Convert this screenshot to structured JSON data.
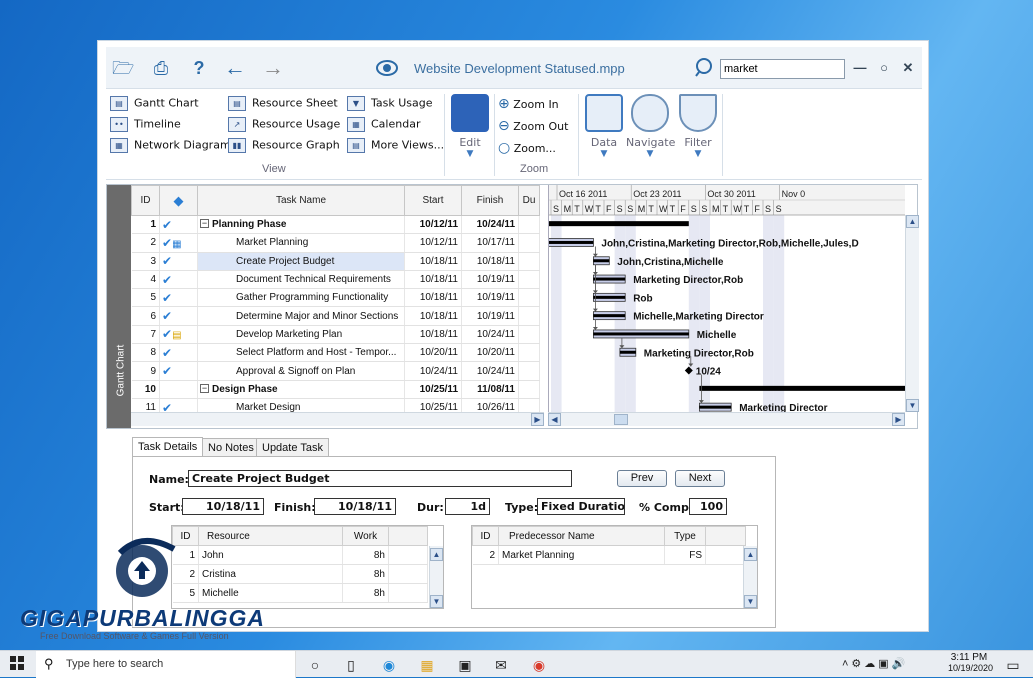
{
  "window": {
    "title": "Website Development Statused.mpp",
    "search_value": "market",
    "toolbar_icons": [
      "folder-open-icon",
      "print-icon",
      "help-icon",
      "back-arrow-icon",
      "forward-arrow-icon",
      "eye-icon"
    ]
  },
  "ribbon": {
    "view_items": [
      {
        "label": "Gantt Chart",
        "icon": "gantt-chart-icon"
      },
      {
        "label": "Timeline",
        "icon": "timeline-icon"
      },
      {
        "label": "Network Diagram",
        "icon": "network-diagram-icon"
      },
      {
        "label": "Resource Sheet",
        "icon": "resource-sheet-icon"
      },
      {
        "label": "Resource Usage",
        "icon": "resource-usage-icon"
      },
      {
        "label": "Resource Graph",
        "icon": "resource-graph-icon"
      },
      {
        "label": "Task Usage",
        "icon": "task-usage-icon"
      },
      {
        "label": "Calendar",
        "icon": "calendar-icon"
      },
      {
        "label": "More Views...",
        "icon": "more-views-icon"
      }
    ],
    "view_group_label": "View",
    "edit_label": "Edit",
    "zoom_items": [
      "Zoom In",
      "Zoom Out",
      "Zoom..."
    ],
    "zoom_group_label": "Zoom",
    "data_label": "Data",
    "navigate_label": "Navigate",
    "filter_label": "Filter"
  },
  "gantt": {
    "side_label": "Gantt Chart",
    "columns": [
      "ID",
      "",
      "Task Name",
      "Start",
      "Finish",
      "Du"
    ],
    "rows": [
      {
        "id": "1",
        "name": "Planning Phase",
        "start": "10/12/11",
        "finish": "10/24/11",
        "summary": true,
        "check": true,
        "extra": ""
      },
      {
        "id": "2",
        "name": "Market Planning",
        "start": "10/12/11",
        "finish": "10/17/11",
        "summary": false,
        "check": true,
        "extra": "table"
      },
      {
        "id": "3",
        "name": "Create Project Budget",
        "start": "10/18/11",
        "finish": "10/18/11",
        "summary": false,
        "check": true,
        "extra": "",
        "selected": true
      },
      {
        "id": "4",
        "name": "Document Technical Requirements",
        "start": "10/18/11",
        "finish": "10/19/11",
        "summary": false,
        "check": true,
        "extra": ""
      },
      {
        "id": "5",
        "name": "Gather Programming Functionality",
        "start": "10/18/11",
        "finish": "10/19/11",
        "summary": false,
        "check": true,
        "extra": ""
      },
      {
        "id": "6",
        "name": "Determine Major and Minor Sections",
        "start": "10/18/11",
        "finish": "10/19/11",
        "summary": false,
        "check": true,
        "extra": ""
      },
      {
        "id": "7",
        "name": "Develop Marketing Plan",
        "start": "10/18/11",
        "finish": "10/24/11",
        "summary": false,
        "check": true,
        "extra": "note"
      },
      {
        "id": "8",
        "name": "Select Platform and Host - Tempor...",
        "start": "10/20/11",
        "finish": "10/20/11",
        "summary": false,
        "check": true,
        "extra": ""
      },
      {
        "id": "9",
        "name": "Approval & Signoff on Plan",
        "start": "10/24/11",
        "finish": "10/24/11",
        "summary": false,
        "check": true,
        "extra": ""
      },
      {
        "id": "10",
        "name": "Design Phase",
        "start": "10/25/11",
        "finish": "11/08/11",
        "summary": true,
        "check": false,
        "extra": ""
      },
      {
        "id": "11",
        "name": "Market Design",
        "start": "10/25/11",
        "finish": "10/26/11",
        "summary": false,
        "check": true,
        "extra": ""
      }
    ],
    "weeks": [
      "Oct 16 2011",
      "Oct 23 2011",
      "Oct 30 2011",
      "Nov 0"
    ],
    "days": [
      "S",
      "M",
      "T",
      "W",
      "T",
      "F",
      "S",
      "S",
      "M",
      "T",
      "W",
      "T",
      "F",
      "S",
      "S",
      "M",
      "T",
      "W",
      "T",
      "F",
      "S",
      "S"
    ],
    "bar_labels": [
      "John,Cristina,Marketing Director,Rob,Michelle,Jules,D",
      "John,Cristina,Michelle",
      "Marketing Director,Rob",
      "Rob",
      "Michelle,Marketing Director",
      "Michelle",
      "Marketing Director,Rob",
      "10/24",
      "Marketing Director"
    ]
  },
  "tabs": [
    "Task Details",
    "No Notes",
    "Update Task"
  ],
  "details": {
    "name_label": "Name:",
    "name_value": "Create Project Budget",
    "prev": "Prev",
    "next": "Next",
    "start_label": "Start:",
    "start_value": "10/18/11",
    "finish_label": "Finish:",
    "finish_value": "10/18/11",
    "dur_label": "Dur:",
    "dur_value": "1d",
    "type_label": "Type:",
    "type_value": "Fixed Duration",
    "comp_label": "% Comp:",
    "comp_value": "100",
    "resources_cols": [
      "ID",
      "Resource",
      "Work"
    ],
    "resources": [
      {
        "id": "1",
        "name": "John",
        "work": "8h"
      },
      {
        "id": "2",
        "name": "Cristina",
        "work": "8h"
      },
      {
        "id": "5",
        "name": "Michelle",
        "work": "8h"
      }
    ],
    "pred_cols": [
      "ID",
      "Predecessor Name",
      "Type"
    ],
    "preds": [
      {
        "id": "2",
        "name": "Market Planning",
        "type": "FS"
      }
    ]
  },
  "watermark": {
    "brand": "GIGAPURBALINGGA",
    "tagline": "Free Download Software & Games Full Version"
  },
  "taskbar": {
    "search_placeholder": "Type here to search",
    "time": "3:11 PM",
    "date": "10/19/2020"
  }
}
